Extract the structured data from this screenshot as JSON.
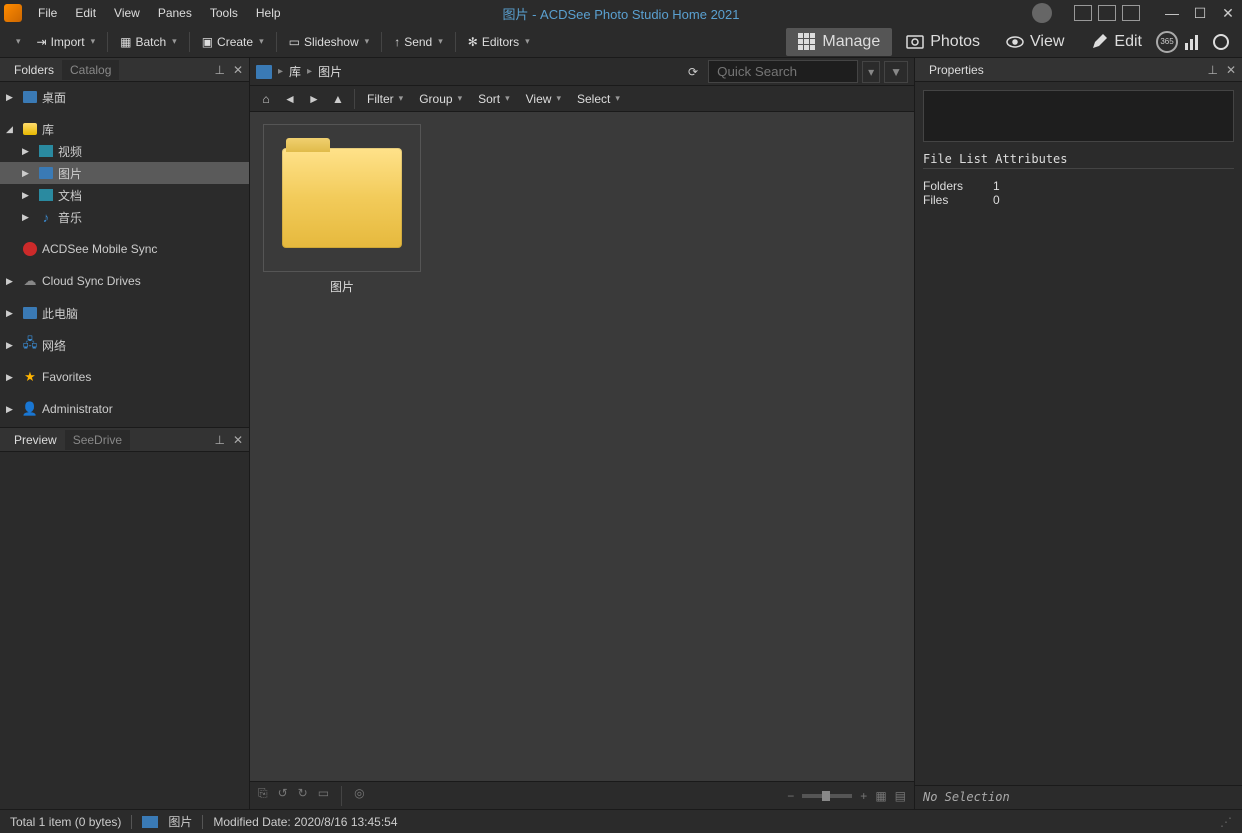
{
  "window": {
    "title": "图片 - ACDSee Photo Studio Home 2021"
  },
  "menubar": [
    "File",
    "Edit",
    "View",
    "Panes",
    "Tools",
    "Help"
  ],
  "toolbar": {
    "import": "Import",
    "batch": "Batch",
    "create": "Create",
    "slideshow": "Slideshow",
    "send": "Send",
    "editors": "Editors"
  },
  "modes": {
    "manage": "Manage",
    "photos": "Photos",
    "view": "View",
    "edit": "Edit",
    "badge365": "365"
  },
  "folders_panel": {
    "tab_folders": "Folders",
    "tab_catalog": "Catalog",
    "items": {
      "desktop": "桌面",
      "library": "库",
      "video": "视频",
      "pictures": "图片",
      "documents": "文档",
      "music": "音乐",
      "mobile_sync": "ACDSee Mobile Sync",
      "cloud": "Cloud Sync Drives",
      "this_pc": "此电脑",
      "network": "网络",
      "favorites": "Favorites",
      "admin": "Administrator"
    }
  },
  "preview_panel": {
    "tab_preview": "Preview",
    "tab_seedrive": "SeeDrive"
  },
  "breadcrumb": {
    "library": "库",
    "pictures": "图片"
  },
  "search": {
    "placeholder": "Quick Search"
  },
  "view_toolbar": {
    "filter": "Filter",
    "group": "Group",
    "sort": "Sort",
    "view": "View",
    "select": "Select"
  },
  "content": {
    "folder_name": "图片"
  },
  "properties": {
    "title": "Properties",
    "section": "File List Attributes",
    "folders_label": "Folders",
    "folders_value": "1",
    "files_label": "Files",
    "files_value": "0",
    "no_selection": "No Selection"
  },
  "statusbar": {
    "total": "Total 1 item  (0 bytes)",
    "current": "图片",
    "modified": "Modified Date: 2020/8/16 13:45:54"
  }
}
